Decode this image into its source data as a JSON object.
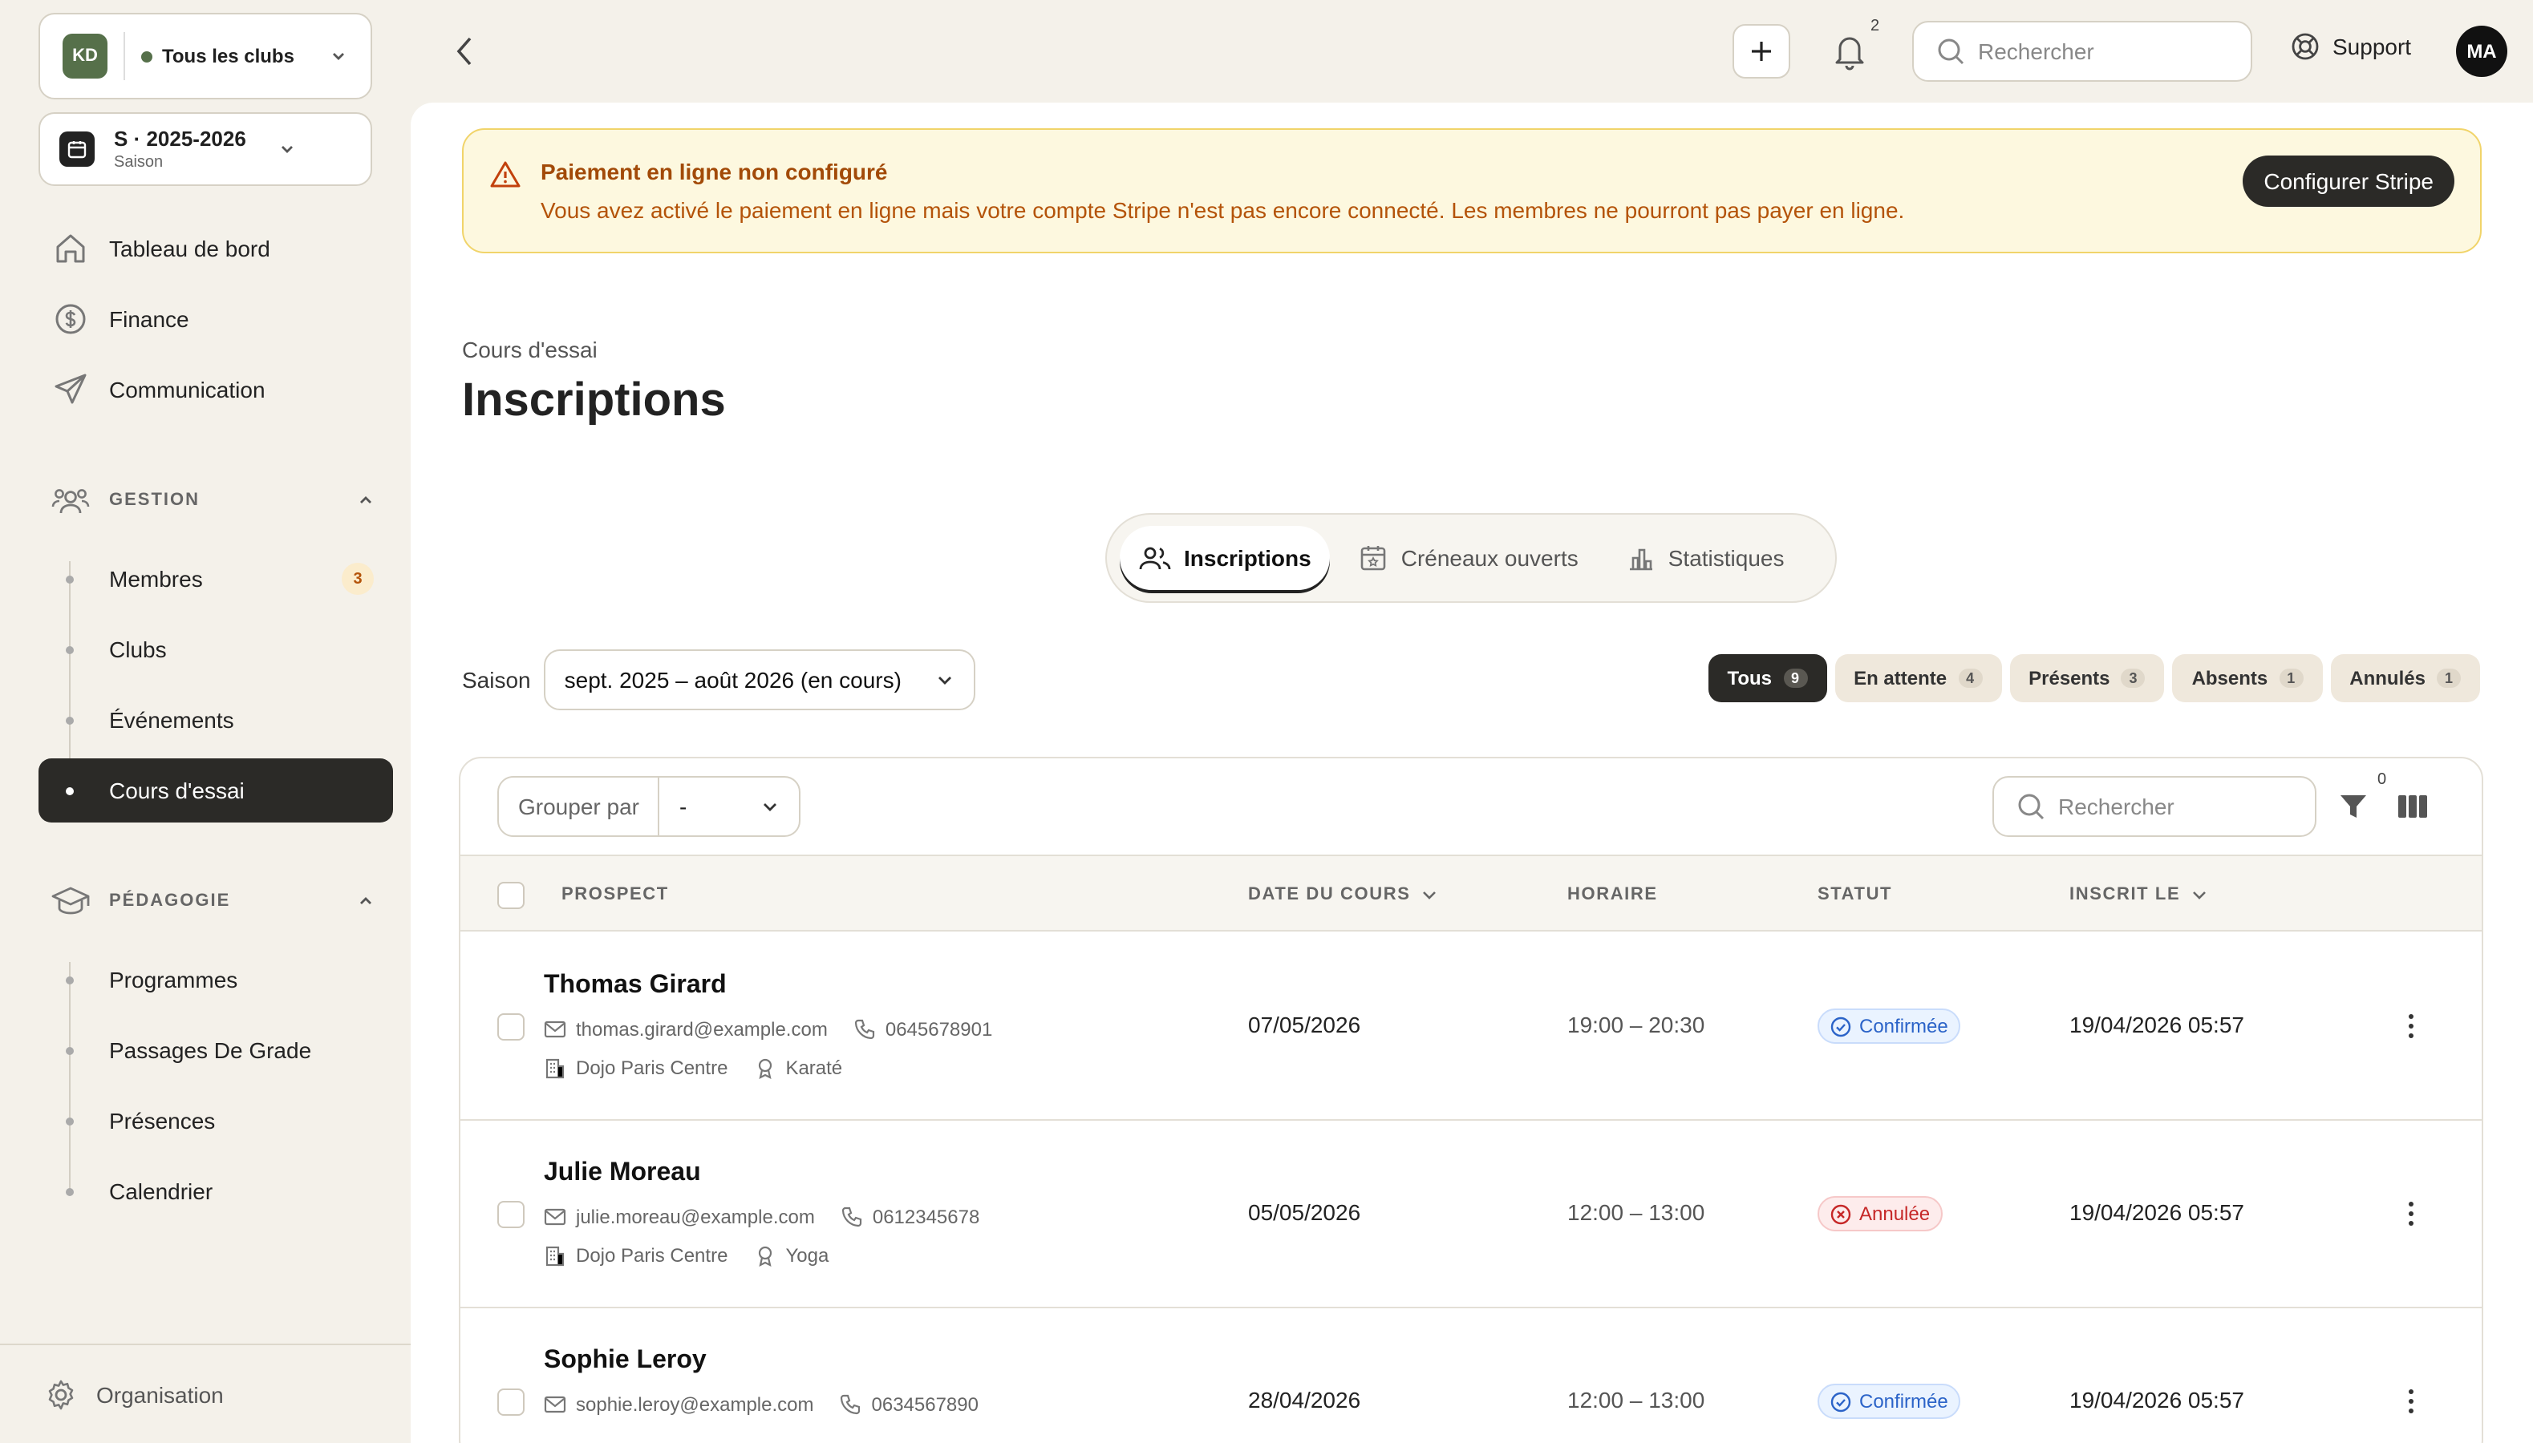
{
  "sidebar": {
    "club": {
      "initials": "KD",
      "name": "Tous les clubs"
    },
    "season": {
      "title": "S · 2025-2026",
      "subtitle": "Saison"
    },
    "nav": [
      {
        "label": "Tableau de bord",
        "icon": "home-icon"
      },
      {
        "label": "Finance",
        "icon": "dollar-circle-icon"
      },
      {
        "label": "Communication",
        "icon": "send-icon"
      }
    ],
    "gestion": {
      "title": "GESTION",
      "items": [
        {
          "label": "Membres",
          "badge": "3"
        },
        {
          "label": "Clubs"
        },
        {
          "label": "Événements"
        },
        {
          "label": "Cours d'essai",
          "active": true
        }
      ]
    },
    "pedagogie": {
      "title": "PÉDAGOGIE",
      "items": [
        {
          "label": "Programmes"
        },
        {
          "label": "Passages De Grade"
        },
        {
          "label": "Présences"
        },
        {
          "label": "Calendrier"
        }
      ]
    },
    "organisation": "Organisation"
  },
  "topbar": {
    "notifications_count": "2",
    "search_placeholder": "Rechercher",
    "support": "Support",
    "avatar": "MA"
  },
  "alert": {
    "title": "Paiement en ligne non configuré",
    "message": "Vous avez activé le paiement en ligne mais votre compte Stripe n'est pas encore connecté. Les membres ne pourront pas payer en ligne.",
    "button": "Configurer Stripe"
  },
  "page": {
    "breadcrumb": "Cours d'essai",
    "title": "Inscriptions"
  },
  "tabs": [
    {
      "label": "Inscriptions",
      "active": true
    },
    {
      "label": "Créneaux ouverts"
    },
    {
      "label": "Statistiques"
    }
  ],
  "season_filter": {
    "label": "Saison",
    "value": "sept. 2025 – août 2026 (en cours)"
  },
  "status_filters": [
    {
      "label": "Tous",
      "count": "9",
      "active": true
    },
    {
      "label": "En attente",
      "count": "4"
    },
    {
      "label": "Présents",
      "count": "3"
    },
    {
      "label": "Absents",
      "count": "1"
    },
    {
      "label": "Annulés",
      "count": "1"
    }
  ],
  "toolbar": {
    "group_by_label": "Grouper par",
    "group_by_value": "-",
    "search_placeholder": "Rechercher",
    "filter_count": "0"
  },
  "columns": {
    "prospect": "PROSPECT",
    "date": "DATE DU COURS",
    "time": "HORAIRE",
    "status": "STATUT",
    "registered": "INSCRIT LE"
  },
  "rows": [
    {
      "name": "Thomas Girard",
      "email": "thomas.girard@example.com",
      "phone": "0645678901",
      "club": "Dojo Paris Centre",
      "discipline": "Karaté",
      "date": "07/05/2026",
      "time": "19:00 – 20:30",
      "status": "Confirmée",
      "registered": "19/04/2026 05:57"
    },
    {
      "name": "Julie Moreau",
      "email": "julie.moreau@example.com",
      "phone": "0612345678",
      "club": "Dojo Paris Centre",
      "discipline": "Yoga",
      "date": "05/05/2026",
      "time": "12:00 – 13:00",
      "status": "Annulée",
      "registered": "19/04/2026 05:57"
    },
    {
      "name": "Sophie Leroy",
      "email": "sophie.leroy@example.com",
      "phone": "0634567890",
      "date": "28/04/2026",
      "time": "12:00 – 13:00",
      "status": "Confirmée",
      "registered": "19/04/2026 05:57"
    }
  ],
  "colors": {
    "accent_dark": "#2b2a27",
    "club_green": "#56704a",
    "alert_bg": "#fdf8df",
    "alert_text": "#b45309",
    "confirm_blue": "#2b63c8",
    "cancel_red": "#c62828"
  }
}
